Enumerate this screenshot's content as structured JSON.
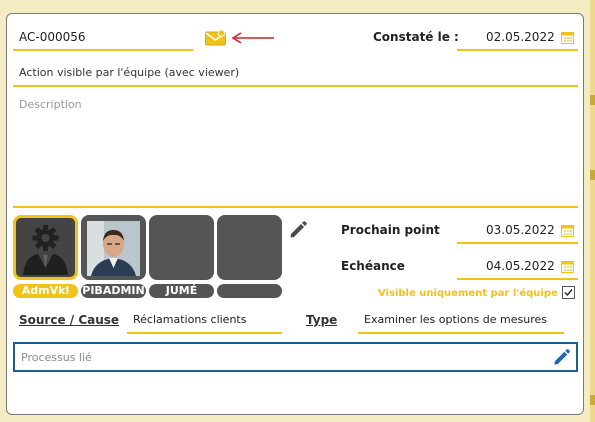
{
  "form": {
    "reference": "AC-000056",
    "constate_label": "Constaté le :",
    "constate_date": "02.05.2022",
    "title": "Action visible par l'équipe (avec viewer)",
    "description_placeholder": "Description",
    "prochain_label": "Prochain point",
    "prochain_date": "03.05.2022",
    "echeance_label": "Echéance",
    "echeance_date": "04.05.2022",
    "visible_label": "Visible uniquement par l'équipe",
    "visible_checked": true,
    "source_label": "Source / Cause",
    "source_value": "Réclamations clients",
    "type_label": "Type",
    "type_value": "Examiner les options de mesures",
    "processus_placeholder": "Processus lié"
  },
  "participants": [
    {
      "name": "AdmVkl",
      "avatar": "gear-person-icon",
      "selected": true
    },
    {
      "name": "PIBADMIN",
      "avatar": "photo",
      "selected": false
    },
    {
      "name": "JUMÉ",
      "avatar": "empty",
      "selected": false
    },
    {
      "name": "",
      "avatar": "empty",
      "selected": false
    }
  ],
  "colors": {
    "accent": "#f1c319",
    "arrow": "#d0212a",
    "focus_border": "#1e5c8e",
    "pen_blue": "#1e6ab0",
    "tile_grey": "#555555"
  }
}
